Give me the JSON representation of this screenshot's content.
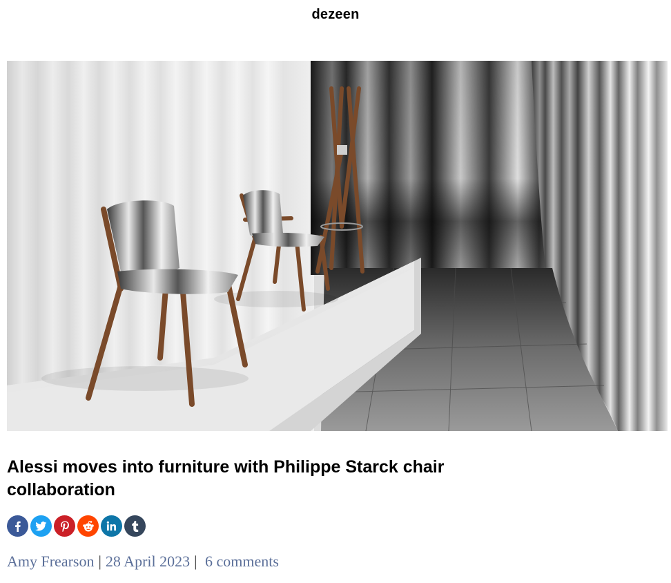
{
  "site": {
    "logo": "dezeen"
  },
  "article": {
    "title": "Alessi moves into furniture with Philippe Starck chair collaboration",
    "author": "Amy Frearson",
    "date": "28 April 2023",
    "comments": "6 comments"
  },
  "share": {
    "buttons": [
      {
        "icon": "facebook-icon",
        "color": "#3b5998"
      },
      {
        "icon": "twitter-icon",
        "color": "#1da1f2"
      },
      {
        "icon": "pinterest-icon",
        "color": "#cb2027"
      },
      {
        "icon": "reddit-icon",
        "color": "#ff4500"
      },
      {
        "icon": "linkedin-icon",
        "color": "#0e76a8"
      },
      {
        "icon": "tumblr-icon",
        "color": "#35465c"
      }
    ]
  }
}
